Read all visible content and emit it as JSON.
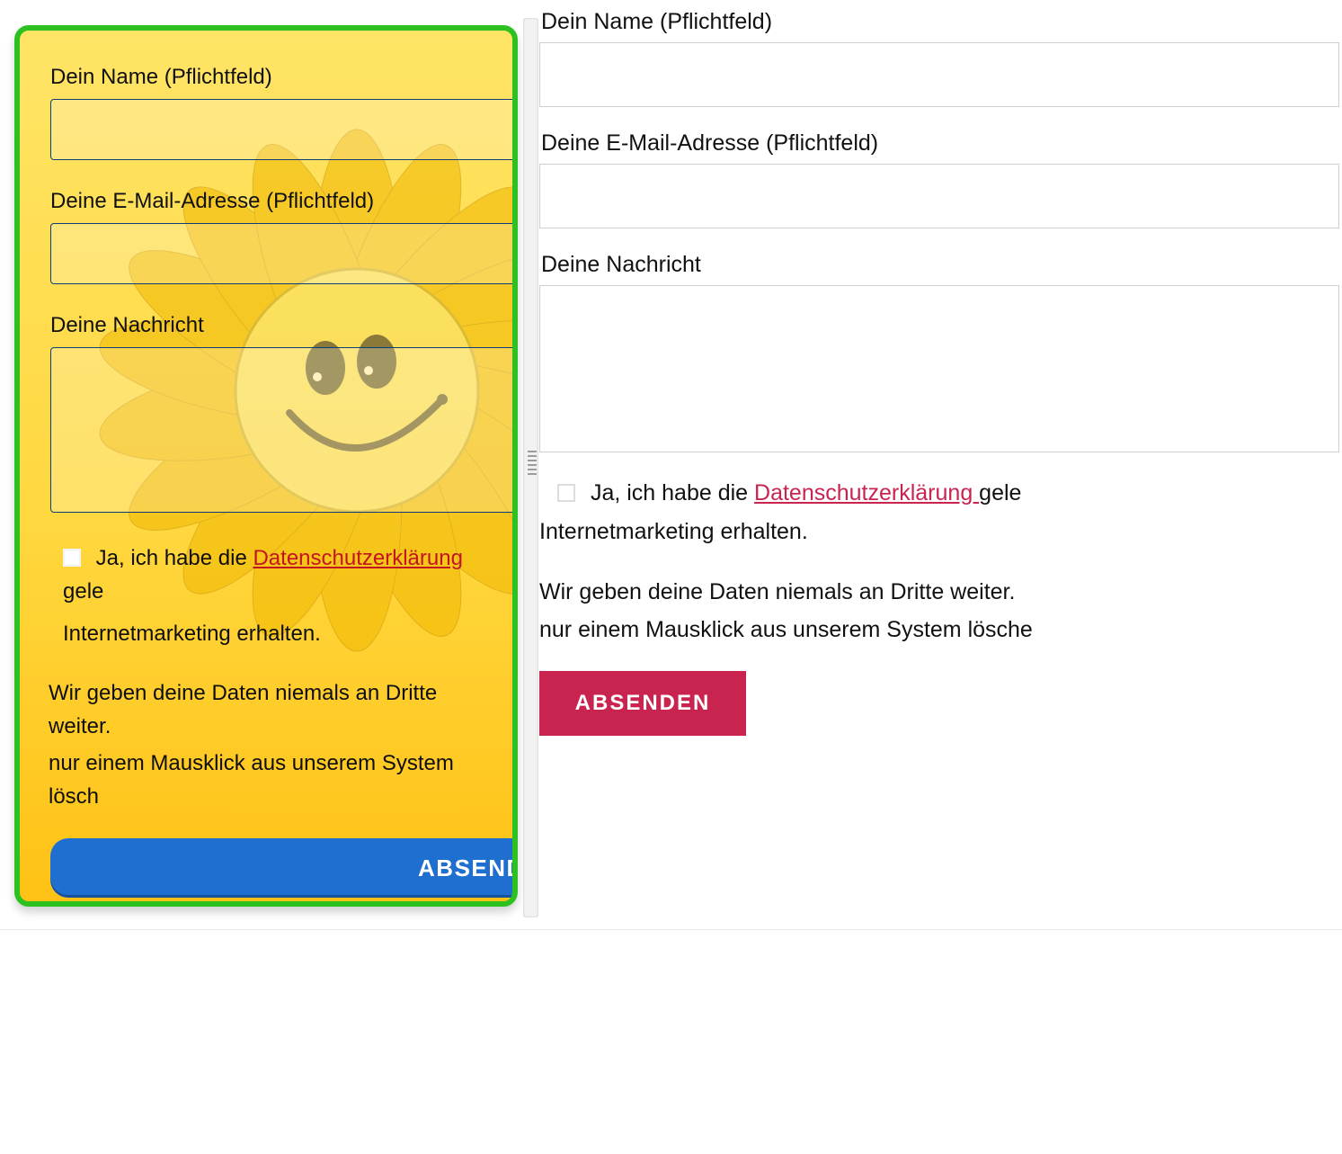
{
  "left": {
    "fields": {
      "name_label": "Dein Name (Pflichtfeld)",
      "email_label": "Deine E-Mail-Adresse (Pflichtfeld)",
      "message_label": "Deine Nachricht"
    },
    "consent": {
      "line1_pre": "Ja, ich habe die ",
      "link": "Datenschutzerklärung ",
      "line1_post": "gele",
      "line2": "Internetmarketing erhalten."
    },
    "privacy": {
      "line1": "Wir geben deine Daten niemals an Dritte weiter.",
      "line2": "nur einem Mausklick aus unserem System lösch"
    },
    "submit": "ABSENDEN"
  },
  "right": {
    "fields": {
      "name_label": "Dein Name (Pflichtfeld)",
      "email_label": "Deine E-Mail-Adresse (Pflichtfeld)",
      "message_label": "Deine Nachricht"
    },
    "consent": {
      "line1_pre": "Ja, ich habe die ",
      "link": "Datenschutzerklärung ",
      "line1_post": "gele",
      "line2": "Internetmarketing erhalten."
    },
    "privacy": {
      "line1": "Wir geben deine Daten niemals an Dritte weiter. ",
      "line2": "nur einem Mausklick aus unserem System lösche"
    },
    "submit": "ABSENDEN"
  }
}
